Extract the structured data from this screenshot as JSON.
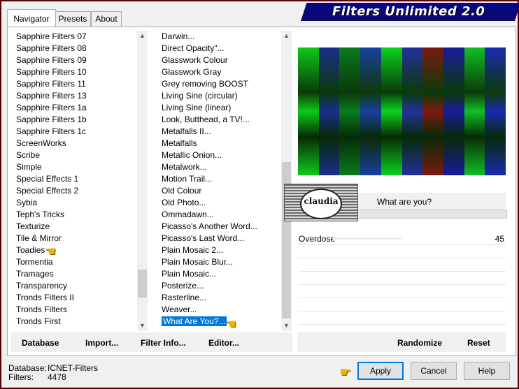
{
  "app": {
    "title": "Filters Unlimited 2.0"
  },
  "tabs": [
    {
      "label": "Navigator",
      "active": true
    },
    {
      "label": "Presets",
      "active": false
    },
    {
      "label": "About",
      "active": false
    }
  ],
  "categories": {
    "items": [
      "Sapphire Filters 07",
      "Sapphire Filters 08",
      "Sapphire Filters 09",
      "Sapphire Filters 10",
      "Sapphire Filters 11",
      "Sapphire Filters 13",
      "Sapphire Filters 1a",
      "Sapphire Filters 1b",
      "Sapphire Filters 1c",
      "ScreenWorks",
      "Scribe",
      "Simple",
      "Special Effects 1",
      "Special Effects 2",
      "Sybia",
      "Teph's Tricks",
      "Texturize",
      "Tile & Mirror",
      "Toadies",
      "Tormentia",
      "Tramages",
      "Transparency",
      "Tronds Filters II",
      "Tronds Filters",
      "Tronds First"
    ],
    "current": "Toadies"
  },
  "filters": {
    "items": [
      "Darwin...",
      "Direct Opacity\"...",
      "Glasswork Colour",
      "Glasswork Gray",
      "Grey removing BOOST",
      "Living Sine (circular)",
      "Living Sine (linear)",
      "Look, Butthead, a TV!...",
      "Metalfalls II...",
      "Metalfalls",
      "Metallic Onion...",
      "Metalwork...",
      "Motion Trail...",
      "Old Colour",
      "Old Photo...",
      "Ommadawn...",
      "Picasso's Another Word...",
      "Picasso's Last Word...",
      "Plain Mosaic 2...",
      "Plain Mosaic Blur...",
      "Plain Mosaic...",
      "Posterize...",
      "Rasterline...",
      "Weaver...",
      "What Are You?..."
    ],
    "selected": "What Are You?..."
  },
  "preview": {
    "bands": [
      "#0fc81a",
      "#1a2e8a",
      "#0a7a1c",
      "#1a3fa0",
      "#0bd21f",
      "#23309a",
      "#7a1a10",
      "#1a1a9a",
      "#10c025",
      "#1a2ab0"
    ],
    "watermark_text": "claudia"
  },
  "params": {
    "title": "What are you?",
    "rows": [
      {
        "name": "Overdose",
        "value": "45"
      }
    ]
  },
  "toolbar": {
    "database": "Database",
    "import": "Import...",
    "filter_info": "Filter Info...",
    "editor": "Editor...",
    "randomize": "Randomize",
    "reset": "Reset"
  },
  "status": {
    "database_label": "Database:",
    "database_value": "ICNET-Filters",
    "filters_label": "Filters:",
    "filters_value": "4478"
  },
  "buttons": {
    "apply": "Apply",
    "cancel": "Cancel",
    "help": "Help"
  },
  "colors": {
    "banner": "#05058a",
    "selection": "#0078d7",
    "frame": "#5a0000"
  }
}
